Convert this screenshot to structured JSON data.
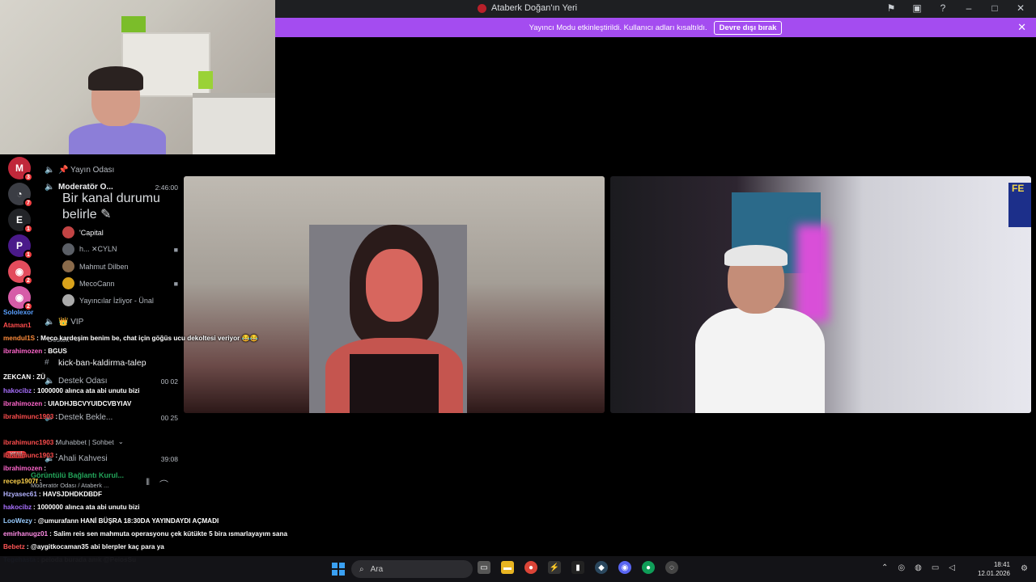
{
  "window": {
    "title": "Ataberk Doğan'ın Yeri",
    "icons": [
      "flag-icon",
      "inbox-icon",
      "help-icon"
    ],
    "controls": [
      "minimize-icon",
      "maximize-icon",
      "close-icon"
    ]
  },
  "banner": {
    "message": "Yayıncı Modu etkinleştirildi. Kullanıcı adları kısaltıldı.",
    "button": "Devre dışı bırak",
    "color": "#a44cf0"
  },
  "guilds": [
    {
      "letter": "M",
      "color": "#c0283a",
      "badge": "3"
    },
    {
      "letter": "◔",
      "color": "#3b3d44",
      "badge": "7"
    },
    {
      "letter": "E",
      "color": "#222428",
      "badge": "1"
    },
    {
      "letter": "P",
      "color": "#4a1a8a",
      "badge": "1"
    },
    {
      "letter": "◉",
      "color": "#e34c5c",
      "badge": "2"
    },
    {
      "letter": "◉",
      "color": "#d65ca8",
      "badge": "2"
    }
  ],
  "channels": {
    "yayin": "📌 Yayın Odası",
    "moderator": "Moderatör O...",
    "moderator_time": "2:46:00",
    "moderator_sub": "Bir kanal durumu belirle ✎",
    "members": [
      "'Capital",
      "h... ✕CYLN",
      "Mahmut Dilben",
      "MecoCann",
      "Yayıncılar İzliyor - Ünal"
    ],
    "vip": "👑 VIP",
    "destek": "Destek",
    "kick": "kick-ban-kaldirma-talep",
    "destek_odasi": "Destek Odası",
    "destek_odasi_nums": "00  02",
    "destek_bekle": "Destek Bekle...",
    "destek_bekle_nums": "00  25",
    "muhabbet": "Muhabbet | Sohbet",
    "ahali": "Ahali Kahvesi",
    "ahali_time": "39:08"
  },
  "voice": {
    "status": "Görüntülü Bağlantı Kurul...",
    "channel": "Moderatör Odası / Ataberk ...",
    "new_badge": "YENİ"
  },
  "chat": [
    {
      "user": "Sololexor",
      "text": "",
      "color": "#5aa0ff"
    },
    {
      "user": "Ataman1",
      "text": "",
      "color": "#ff4d4d"
    },
    {
      "user": "mendul1S",
      "text": ": Meco kardeşim benim be, chat için göğüs ucu dekoltesi veriyor 😂😂",
      "color": "#ff8c3b"
    },
    {
      "user": "ibrahimozen",
      "text": ": BGUS",
      "color": "#ff66cc"
    },
    {
      "user": "",
      "text": "",
      "color": "#ffffff"
    },
    {
      "user": "ZEKCAN",
      "text": ": ZÜ",
      "color": "#ffffff"
    },
    {
      "user": "hakocibz",
      "text": ": 1000000 alınca ata abi unutu bizi",
      "color": "#a970ff"
    },
    {
      "user": "ibrahimozen",
      "text": ": UIADHJBCVYUIDCVBYIAV",
      "color": "#ff66cc"
    },
    {
      "user": "ibrahimunc1903",
      "text": ":",
      "color": "#ff4d4d"
    },
    {
      "user": "",
      "text": "",
      "color": "#ffffff"
    },
    {
      "user": "ibrahimunc1903",
      "text": ":",
      "color": "#ff4d4d"
    },
    {
      "user": "ibrahimunc1903",
      "text": ":",
      "color": "#ff4d4d"
    },
    {
      "user": "ibrahimozen",
      "text": ":",
      "color": "#ff66cc"
    },
    {
      "user": "recep1907f",
      "text": ":",
      "color": "#ffd34d"
    },
    {
      "user": "Hzyasec61",
      "text": ": HAVSJDHDKDBDF",
      "color": "#b3b3ff"
    },
    {
      "user": "hakocibz",
      "text": ": 1000000 alınca ata abi unutu bizi",
      "color": "#a970ff"
    },
    {
      "user": "LooWezy",
      "text": ": @umurafann HANİ BÜŞRA 18:30DA YAYINDAYDI AÇMADI",
      "color": "#9cf"
    },
    {
      "user": "emirhanugz01",
      "text": ": Salim reis sen mahmuta operasyonu çek kütükte 5 bira ısmarlayayım sana",
      "color": "#ff8ce6"
    },
    {
      "user": "Bebetz",
      "text": ": @aygitkocaman35 abi blerpler kaç para ya",
      "color": "#ff5555"
    },
    {
      "user": "Tegehasta",
      "text": ": peloda burada amk @PelosSu",
      "color": "#6fa0ff"
    }
  ],
  "taskbar": {
    "search_placeholder": "Ara",
    "time": "18:41",
    "date": "12.01.2026"
  }
}
